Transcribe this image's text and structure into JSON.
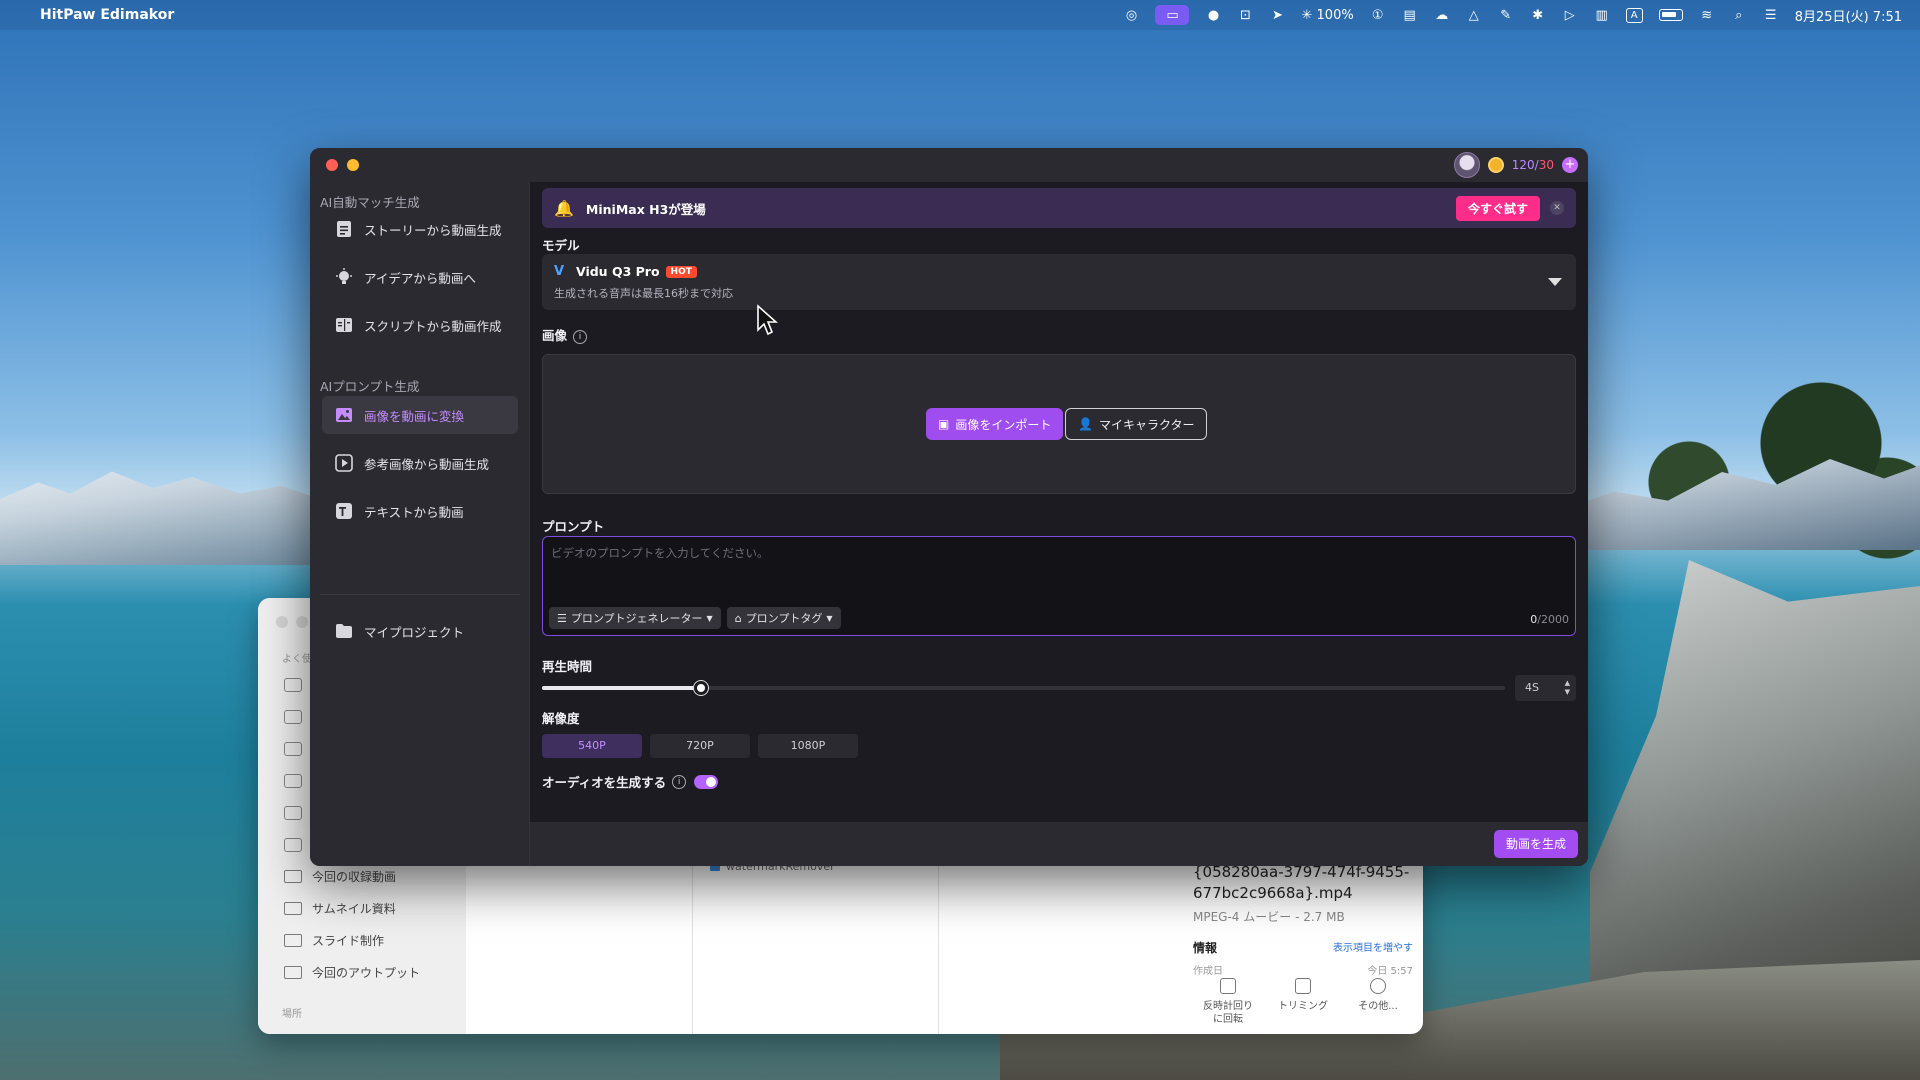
{
  "menubar": {
    "app_name": "HitPaw Edimakor",
    "brightness": "100%",
    "input_indicator": "A",
    "datetime": "8月25日(火) 7:51"
  },
  "finder": {
    "sidebar_label": "よく使",
    "folders": [
      "今回の収録動画",
      "サムネイル資料",
      "スライド制作",
      "今回のアウトプット"
    ],
    "footer_label": "場所",
    "file_partial": "watermarkRemover",
    "info": {
      "filename": "{058280aa-3797-474f-9455-677bc2c9668a}.mp4",
      "meta": "MPEG-4 ムービー - 2.7 MB",
      "info_title": "情報",
      "more_link": "表示項目を増やす",
      "partial_left": "作成日",
      "partial_right": "今日 5:57"
    },
    "actions": [
      "反時計回り\nに回転",
      "トリミング",
      "その他..."
    ]
  },
  "app": {
    "credits_current": "120",
    "credits_max": "30",
    "sidebar": {
      "section1": "AI自動マッチ生成",
      "items1": [
        {
          "label": "ストーリーから動画生成",
          "icon": "document-icon"
        },
        {
          "label": "アイデアから動画へ",
          "icon": "lightbulb-icon"
        },
        {
          "label": "スクリプトから動画作成",
          "icon": "script-icon"
        }
      ],
      "section2": "AIプロンプト生成",
      "items2": [
        {
          "label": "画像を動画に変換",
          "icon": "image-icon",
          "active": true
        },
        {
          "label": "参考画像から動画生成",
          "icon": "reference-video-icon"
        },
        {
          "label": "テキストから動画",
          "icon": "text-icon"
        }
      ],
      "project": "マイプロジェクト"
    },
    "banner": {
      "text": "MiniMax H3が登場",
      "button": "今すぐ試す"
    },
    "model": {
      "label": "モデル",
      "name": "Vidu Q3 Pro",
      "badge": "HOT",
      "desc": "生成される音声は最長16秒まで対応"
    },
    "image": {
      "label": "画像",
      "import_button": "画像をインポート",
      "character_button": "マイキャラクター"
    },
    "prompt": {
      "label": "プロンプト",
      "placeholder": "ビデオのプロンプトを入力してください。",
      "generator": "プロンプトジェネレーター",
      "tag": "プロンプトタグ",
      "count": "0",
      "max": "/2000"
    },
    "duration": {
      "label": "再生時間",
      "value": "4S",
      "fraction": 0.165
    },
    "resolution": {
      "label": "解像度",
      "options": [
        "540P",
        "720P",
        "1080P"
      ],
      "selected": "540P"
    },
    "audio": {
      "label": "オーディオを生成する",
      "enabled": true
    },
    "generate_button": "動画を生成"
  }
}
